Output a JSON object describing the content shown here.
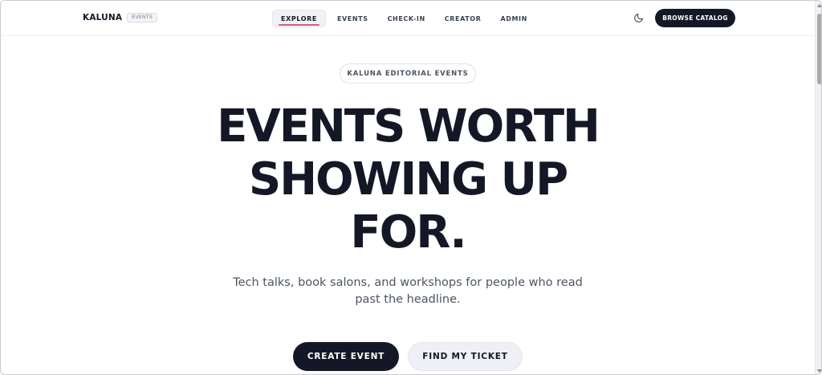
{
  "brand": {
    "name": "KALUNA",
    "badge": "EVENTS"
  },
  "nav": {
    "items": [
      {
        "label": "EXPLORE",
        "active": true
      },
      {
        "label": "EVENTS",
        "active": false
      },
      {
        "label": "CHECK-IN",
        "active": false
      },
      {
        "label": "CREATOR",
        "active": false
      },
      {
        "label": "ADMIN",
        "active": false
      }
    ]
  },
  "header": {
    "theme_icon": "moon-icon",
    "browse_label": "BROWSE CATALOG"
  },
  "hero": {
    "eyebrow": "KALUNA EDITORIAL EVENTS",
    "headline_line1": "EVENTS WORTH",
    "headline_line2": "SHOWING UP",
    "headline_line3": "FOR.",
    "subtitle_line1": "Tech talks, book salons, and workshops for people who read",
    "subtitle_line2": "past the headline.",
    "primary_cta": "CREATE EVENT",
    "secondary_cta": "FIND MY TICKET"
  },
  "colors": {
    "ink": "#141826",
    "accent_underline": "#e2558f",
    "muted_text": "#4b5563",
    "secondary_button_bg": "#eef0f5"
  }
}
